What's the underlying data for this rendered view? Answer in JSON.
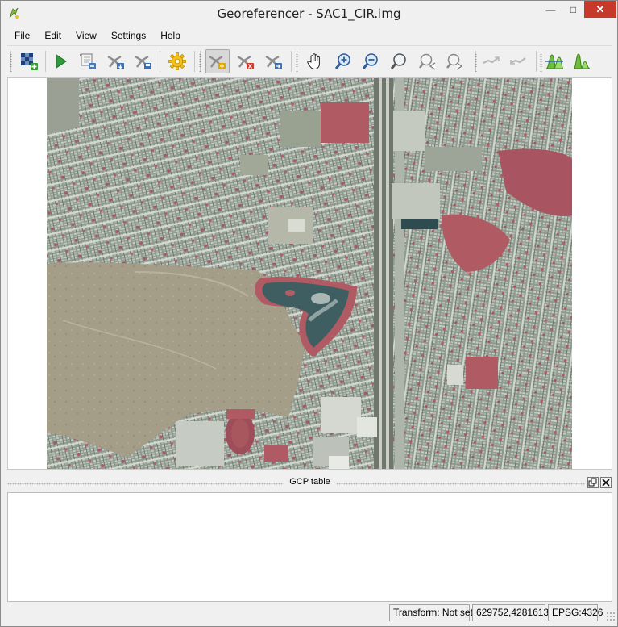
{
  "window": {
    "title": "Georeferencer - SAC1_CIR.img",
    "controls": {
      "minimize": "—",
      "maximize": "□",
      "close": "✕"
    }
  },
  "menu": [
    {
      "label": "File"
    },
    {
      "label": "Edit"
    },
    {
      "label": "View"
    },
    {
      "label": "Settings"
    },
    {
      "label": "Help"
    }
  ],
  "toolbar": {
    "buttons": [
      {
        "name": "open-raster-icon"
      },
      {
        "name": "start-georeferencing-icon"
      },
      {
        "name": "generate-gdal-script-icon"
      },
      {
        "name": "load-gcp-points-icon"
      },
      {
        "name": "save-gcp-points-icon"
      },
      {
        "name": "transformation-settings-icon"
      },
      {
        "name": "add-point-icon",
        "active": true
      },
      {
        "name": "delete-point-icon"
      },
      {
        "name": "move-gcp-point-icon"
      },
      {
        "name": "pan-icon"
      },
      {
        "name": "zoom-in-icon"
      },
      {
        "name": "zoom-out-icon"
      },
      {
        "name": "zoom-to-layer-icon"
      },
      {
        "name": "zoom-last-icon"
      },
      {
        "name": "zoom-next-icon"
      },
      {
        "name": "link-georeferencer-to-qgis-icon"
      },
      {
        "name": "link-qgis-to-georeferencer-icon"
      },
      {
        "name": "full-histogram-stretch-icon"
      },
      {
        "name": "local-histogram-stretch-icon"
      }
    ]
  },
  "image": {
    "name": "SAC1_CIR.img",
    "type": "aerial-color-infrared"
  },
  "gcp_dock": {
    "title": "GCP table",
    "float_icon": "float-icon",
    "close_icon": "close-icon"
  },
  "status": {
    "transform": "Transform: Not set",
    "coordinates": "629752,4281613",
    "crs": "EPSG:4326"
  },
  "colors": {
    "chrome": "#f0f0f0",
    "close": "#c7392b",
    "raster_grey": "#8a9488",
    "raster_red": "#b05a64",
    "water": "#3c5a5c",
    "open_field": "#a49d88"
  }
}
